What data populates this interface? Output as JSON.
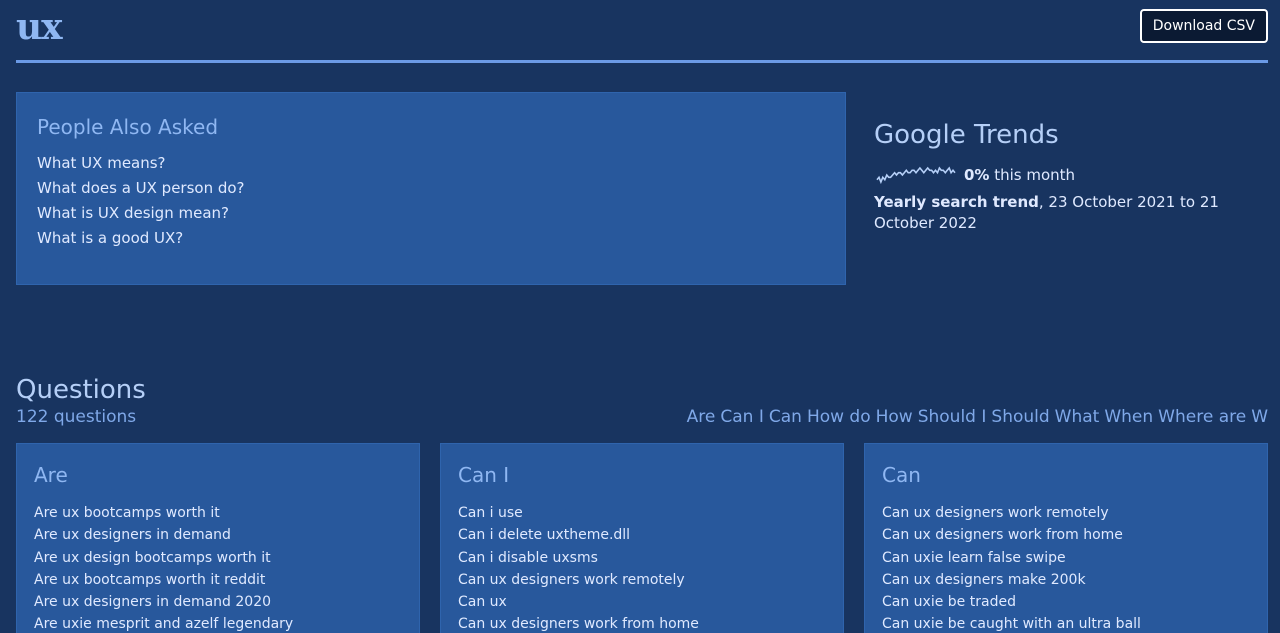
{
  "header": {
    "logo": "ux",
    "download_button": "Download CSV"
  },
  "people_also_asked": {
    "title": "People Also Asked",
    "items": [
      "What UX means?",
      "What does a UX person do?",
      "What is UX design mean?",
      "What is a good UX?"
    ]
  },
  "google_trends": {
    "title": "Google Trends",
    "percent": "0%",
    "period_text": " this month",
    "trend_label": "Yearly search trend",
    "trend_range": ", 23 October 2021 to 21 October 2022",
    "sparkline_values": [
      12,
      13,
      11,
      13,
      12,
      14,
      13,
      13,
      14,
      15,
      14,
      15,
      15,
      14,
      15,
      16,
      15,
      15,
      16,
      16,
      15,
      16,
      17,
      16,
      15,
      16,
      17,
      16,
      16,
      15,
      16,
      15,
      17,
      16,
      16,
      15,
      16,
      17,
      15,
      16,
      15
    ]
  },
  "questions": {
    "heading": "Questions",
    "count": "122 questions",
    "nav": [
      "Are",
      "Can I",
      "Can",
      "How do",
      "How",
      "Should I",
      "Should",
      "What",
      "When",
      "Where are",
      "W"
    ],
    "cards": [
      {
        "title": "Are",
        "items": [
          "Are ux bootcamps worth it",
          "Are ux designers in demand",
          "Are ux design bootcamps worth it",
          "Are ux bootcamps worth it reddit",
          "Are ux designers in demand 2020",
          "Are uxie mesprit and azelf legendary"
        ]
      },
      {
        "title": "Can I",
        "items": [
          "Can i use",
          "Can i delete uxtheme.dll",
          "Can i disable uxsms",
          "Can ux designers work remotely",
          "Can ux",
          "Can ux designers work from home"
        ]
      },
      {
        "title": "Can",
        "items": [
          "Can ux designers work remotely",
          "Can ux designers work from home",
          "Can uxie learn false swipe",
          "Can ux designers make 200k",
          "Can uxie be traded",
          "Can uxie be caught with an ultra ball"
        ]
      }
    ]
  },
  "colors": {
    "background": "#183460",
    "panel": "#28589c",
    "accent": "#6b9ae6"
  }
}
